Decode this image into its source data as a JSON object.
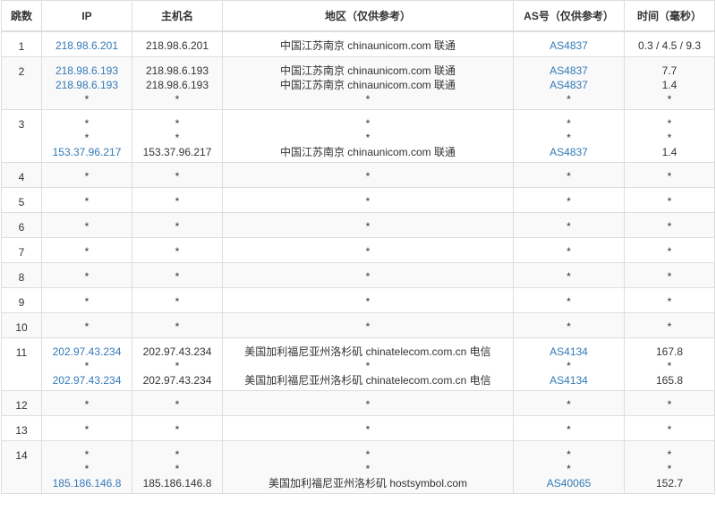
{
  "headers": {
    "hop": "跳数",
    "ip": "IP",
    "host": "主机名",
    "region": "地区（仅供参考）",
    "as": "AS号（仅供参考）",
    "time": "时间（毫秒）"
  },
  "rows": [
    {
      "hop": "1",
      "ip": [
        "218.98.6.201"
      ],
      "host": [
        "218.98.6.201"
      ],
      "region": [
        "中国江苏南京 chinaunicom.com 联通"
      ],
      "as": [
        "AS4837"
      ],
      "time": [
        "0.3 / 4.5 / 9.3"
      ]
    },
    {
      "hop": "2",
      "ip": [
        "218.98.6.193",
        "218.98.6.193",
        "*"
      ],
      "host": [
        "218.98.6.193",
        "218.98.6.193",
        "*"
      ],
      "region": [
        "中国江苏南京 chinaunicom.com 联通",
        "中国江苏南京 chinaunicom.com 联通",
        "*"
      ],
      "as": [
        "AS4837",
        "AS4837",
        "*"
      ],
      "time": [
        "7.7",
        "1.4",
        "*"
      ]
    },
    {
      "hop": "3",
      "ip": [
        "*",
        "*",
        "153.37.96.217"
      ],
      "host": [
        "*",
        "*",
        "153.37.96.217"
      ],
      "region": [
        "*",
        "*",
        "中国江苏南京 chinaunicom.com 联通"
      ],
      "as": [
        "*",
        "*",
        "AS4837"
      ],
      "time": [
        "*",
        "*",
        "1.4"
      ]
    },
    {
      "hop": "4",
      "ip": [
        "*"
      ],
      "host": [
        "*"
      ],
      "region": [
        "*"
      ],
      "as": [
        "*"
      ],
      "time": [
        "*"
      ]
    },
    {
      "hop": "5",
      "ip": [
        "*"
      ],
      "host": [
        "*"
      ],
      "region": [
        "*"
      ],
      "as": [
        "*"
      ],
      "time": [
        "*"
      ]
    },
    {
      "hop": "6",
      "ip": [
        "*"
      ],
      "host": [
        "*"
      ],
      "region": [
        "*"
      ],
      "as": [
        "*"
      ],
      "time": [
        "*"
      ]
    },
    {
      "hop": "7",
      "ip": [
        "*"
      ],
      "host": [
        "*"
      ],
      "region": [
        "*"
      ],
      "as": [
        "*"
      ],
      "time": [
        "*"
      ]
    },
    {
      "hop": "8",
      "ip": [
        "*"
      ],
      "host": [
        "*"
      ],
      "region": [
        "*"
      ],
      "as": [
        "*"
      ],
      "time": [
        "*"
      ]
    },
    {
      "hop": "9",
      "ip": [
        "*"
      ],
      "host": [
        "*"
      ],
      "region": [
        "*"
      ],
      "as": [
        "*"
      ],
      "time": [
        "*"
      ]
    },
    {
      "hop": "10",
      "ip": [
        "*"
      ],
      "host": [
        "*"
      ],
      "region": [
        "*"
      ],
      "as": [
        "*"
      ],
      "time": [
        "*"
      ]
    },
    {
      "hop": "11",
      "ip": [
        "202.97.43.234",
        "*",
        "202.97.43.234"
      ],
      "host": [
        "202.97.43.234",
        "*",
        "202.97.43.234"
      ],
      "region": [
        "美国加利福尼亚州洛杉矶 chinatelecom.com.cn 电信",
        "*",
        "美国加利福尼亚州洛杉矶 chinatelecom.com.cn 电信"
      ],
      "as": [
        "AS4134",
        "*",
        "AS4134"
      ],
      "time": [
        "167.8",
        "*",
        "165.8"
      ]
    },
    {
      "hop": "12",
      "ip": [
        "*"
      ],
      "host": [
        "*"
      ],
      "region": [
        "*"
      ],
      "as": [
        "*"
      ],
      "time": [
        "*"
      ]
    },
    {
      "hop": "13",
      "ip": [
        "*"
      ],
      "host": [
        "*"
      ],
      "region": [
        "*"
      ],
      "as": [
        "*"
      ],
      "time": [
        "*"
      ]
    },
    {
      "hop": "14",
      "ip": [
        "*",
        "*",
        "185.186.146.8"
      ],
      "host": [
        "*",
        "*",
        "185.186.146.8"
      ],
      "region": [
        "*",
        "*",
        "美国加利福尼亚州洛杉矶 hostsymbol.com"
      ],
      "as": [
        "*",
        "*",
        "AS40065"
      ],
      "time": [
        "*",
        "*",
        "152.7"
      ]
    }
  ],
  "colors": {
    "link": "#337ab7",
    "border": "#dddddd",
    "stripe": "#f9f9f9",
    "text": "#333333"
  }
}
